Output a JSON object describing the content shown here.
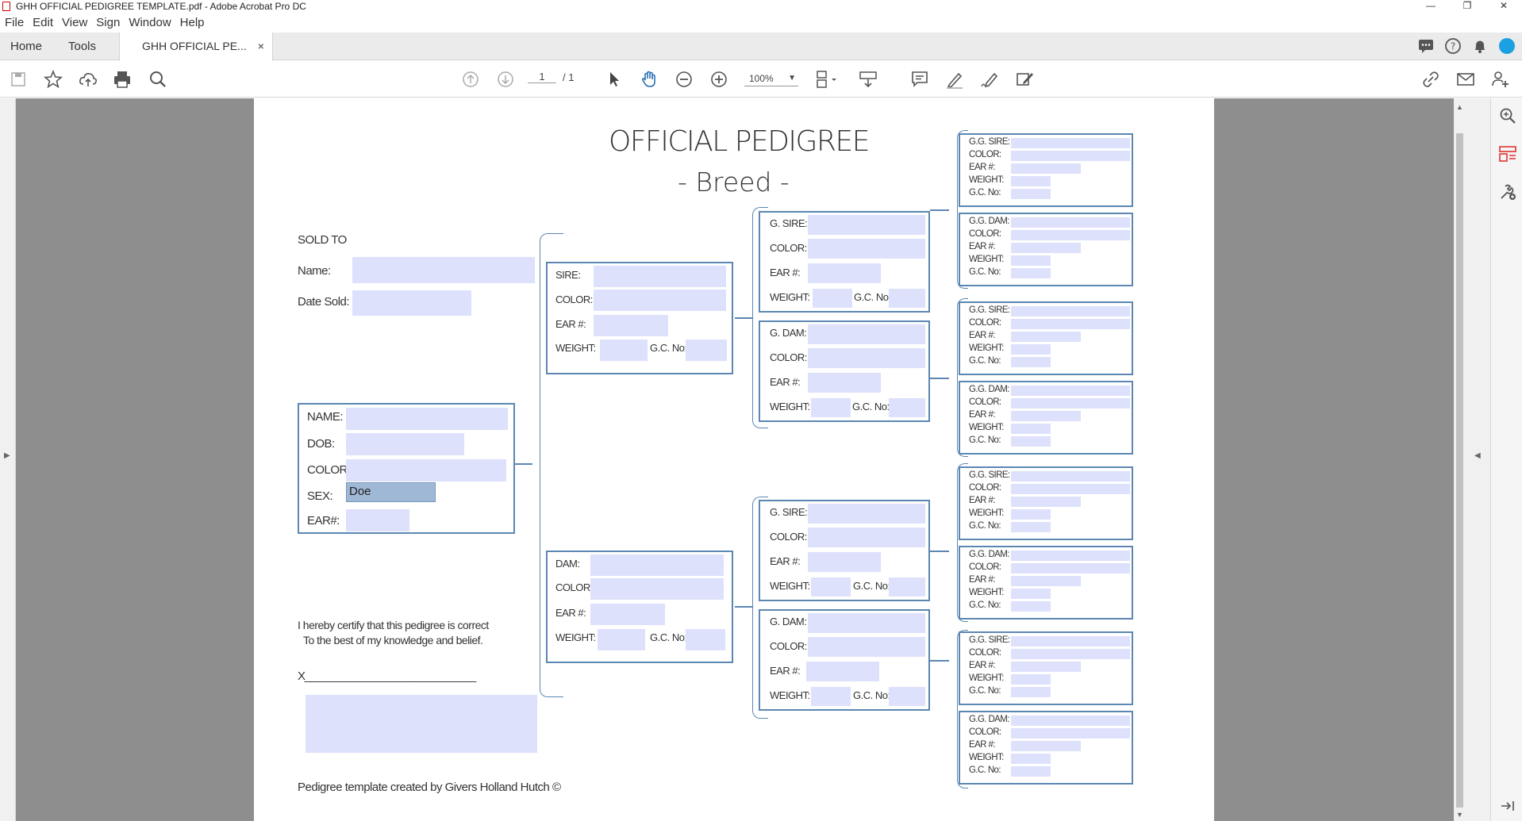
{
  "window": {
    "title": "GHH OFFICIAL PEDIGREE TEMPLATE.pdf - Adobe Acrobat Pro DC",
    "controls": [
      "—",
      "❐",
      "✕"
    ]
  },
  "menu": [
    "File",
    "Edit",
    "View",
    "Sign",
    "Window",
    "Help"
  ],
  "tabs": {
    "home": "Home",
    "tools": "Tools",
    "doc": "GHH OFFICIAL PE...",
    "close": "×"
  },
  "toolbar": {
    "page_current": "1",
    "page_total": "/ 1",
    "zoom": "100%"
  },
  "document": {
    "title": "OFFICIAL PEDIGREE",
    "subtitle": "- Breed -",
    "sold_to": {
      "heading": "SOLD TO",
      "name_label": "Name:",
      "date_label": "Date Sold:"
    },
    "animal": {
      "name_label": "NAME:",
      "dob_label": "DOB:",
      "color_label": "COLOR:",
      "sex_label": "SEX:",
      "sex_value": "Doe",
      "ear_label": "EAR#:"
    },
    "certify_line1": "I hereby certify that this pedigree is correct",
    "certify_line2": "To the best of my knowledge and belief.",
    "sign_line": "X_______________________________",
    "footer": "Pedigree template created by Givers Holland Hutch ©",
    "sire": {
      "title": "SIRE:",
      "color": "COLOR:",
      "ear": "EAR #:",
      "weight": "WEIGHT:",
      "gc": "G.C. No:"
    },
    "dam": {
      "title": "DAM:",
      "color": "COLOR:",
      "ear": "EAR #:",
      "weight": "WEIGHT:",
      "gc": "G.C. No:"
    },
    "gsire": {
      "title": "G. SIRE:",
      "color": "COLOR:",
      "ear": "EAR #:",
      "weight": "WEIGHT:",
      "gc": "G.C. No:"
    },
    "gdam": {
      "title": "G. DAM:",
      "color": "COLOR:",
      "ear": "EAR #:",
      "weight": "WEIGHT:",
      "gc": "G.C. No:"
    },
    "ggsire": {
      "title": "G.G. SIRE:",
      "color": "COLOR:",
      "ear": "EAR #:",
      "weight": "WEIGHT:",
      "gc": "G.C. No:"
    },
    "ggdam": {
      "title": "G.G. DAM:",
      "color": "COLOR:",
      "ear": "EAR #:",
      "weight": "WEIGHT:",
      "gc": "G.C. No:"
    }
  },
  "colors": {
    "field": "#dde1fb",
    "box_border": "#5b87b2",
    "canvas": "#8e8e8e",
    "avatar": "#1ba1e2"
  }
}
